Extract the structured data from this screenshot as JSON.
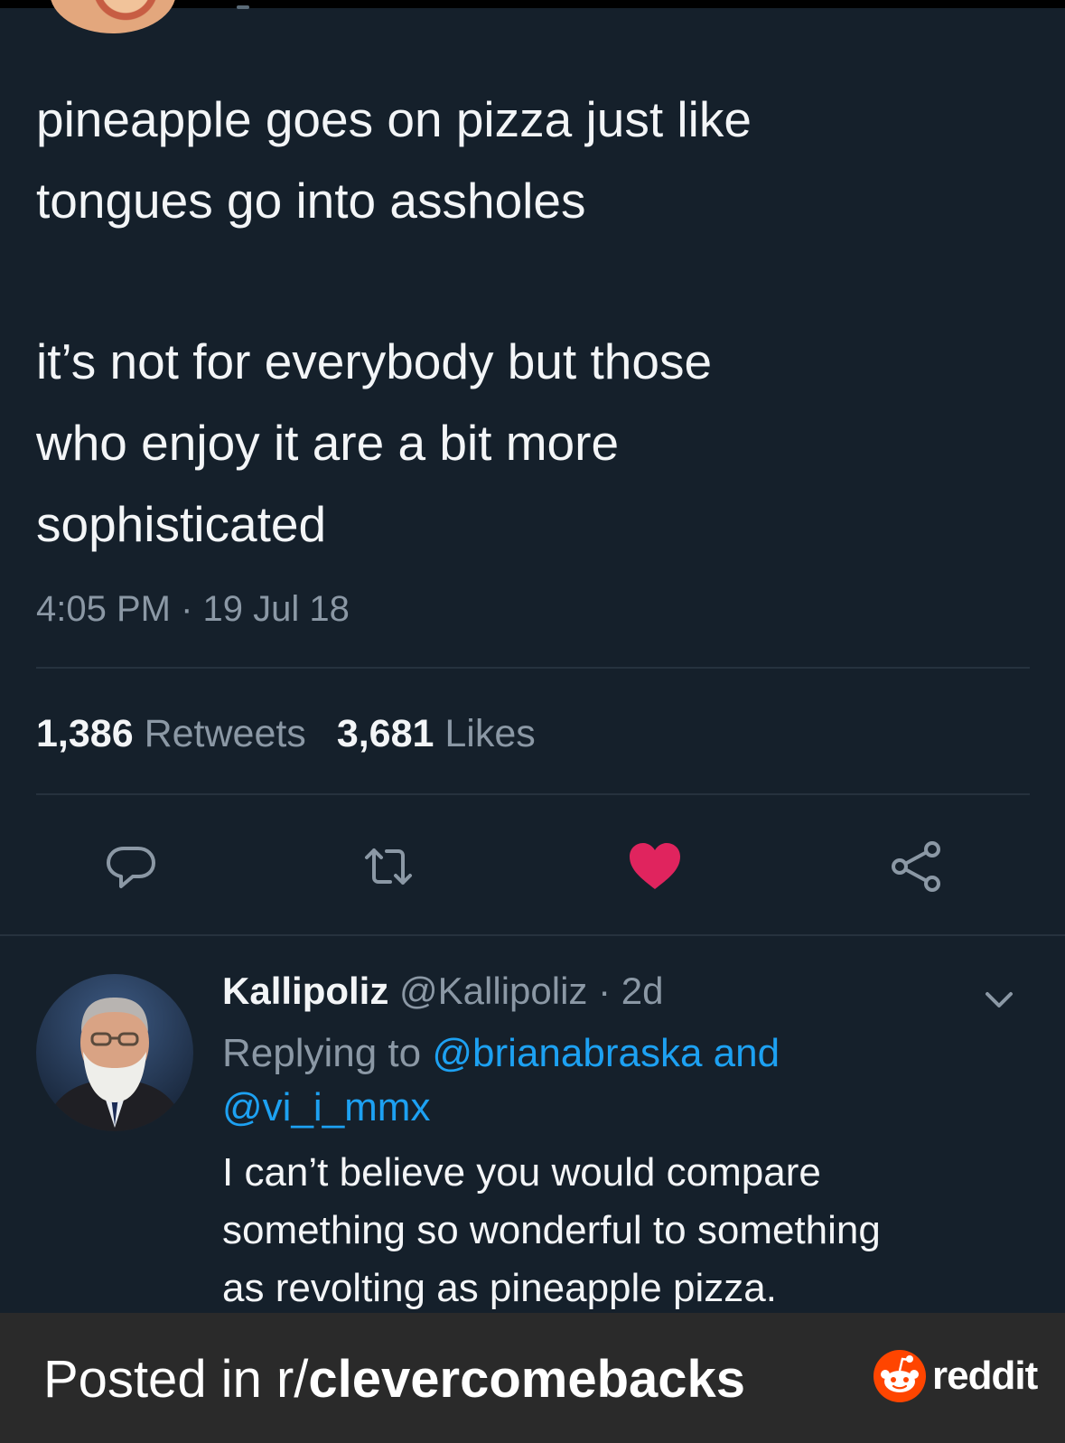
{
  "colors": {
    "background": "#15202b",
    "primary_text": "#f3f5f7",
    "secondary_text": "#8b98a5",
    "link": "#1da1f2",
    "like": "#e0245e",
    "footer_bg": "#2a2a2a",
    "reddit_orange": "#ff4500"
  },
  "tweet": {
    "paragraph1_line1": "pineapple goes on pizza just like",
    "paragraph1_line2": "tongues go into assholes",
    "paragraph2_line1": "it’s not for everybody but those",
    "paragraph2_line2": "who enjoy it are a bit more",
    "paragraph2_line3": "sophisticated",
    "timestamp": "4:05 PM · 19 Jul 18",
    "retweet_count": "1,386",
    "retweet_label": "Retweets",
    "like_count": "3,681",
    "like_label": "Likes",
    "liked": true
  },
  "actions": [
    {
      "name": "reply-icon"
    },
    {
      "name": "retweet-icon"
    },
    {
      "name": "heart-icon"
    },
    {
      "name": "share-icon"
    }
  ],
  "reply": {
    "display_name": "Kallipoliz",
    "handle": "@Kallipoliz",
    "age": "· 2d",
    "replying_prefix": "Replying to",
    "mention1": "@brianabraska",
    "and_word": "and",
    "mention2": "@vi_i_mmx",
    "text_line1": "I can’t believe you would compare",
    "text_line2": "something so wonderful to something",
    "text_line3": "as revolting as pineapple pizza."
  },
  "footer": {
    "prefix": "Posted in r/",
    "subreddit": "clevercomebacks",
    "brand": "reddit"
  }
}
